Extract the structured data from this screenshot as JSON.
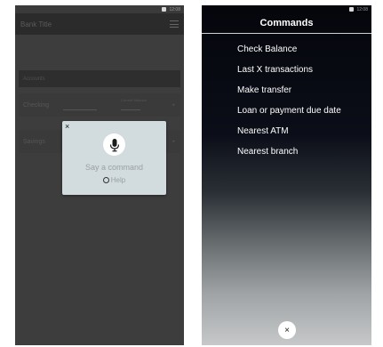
{
  "left_screen": {
    "status_time": "12:08",
    "app_title": "Bank Title",
    "accounts_header": "Accounts",
    "accounts": [
      {
        "name": "Checking",
        "field_label": "Current Balance"
      },
      {
        "name": "Savings",
        "field_label": "Current Balance"
      }
    ],
    "voice_dialog": {
      "close_glyph": "×",
      "prompt": "Say a command",
      "help": "Help"
    }
  },
  "right_screen": {
    "status_time": "12:08",
    "title": "Commands",
    "commands": [
      "Check Balance",
      "Last X transactions",
      "Make transfer",
      "Loan or payment due date",
      "Nearest ATM",
      "Nearest branch"
    ],
    "close_glyph": "×"
  },
  "colors": {
    "dialog_bg": "#d2dbdd",
    "dark_overlay": "#3d3d3d",
    "commands_bg_top": "#05060c",
    "commands_bg_bottom": "#c6c8c9"
  },
  "icons": [
    "microphone-icon",
    "close-icon",
    "help-ring-icon",
    "menu-icon"
  ]
}
